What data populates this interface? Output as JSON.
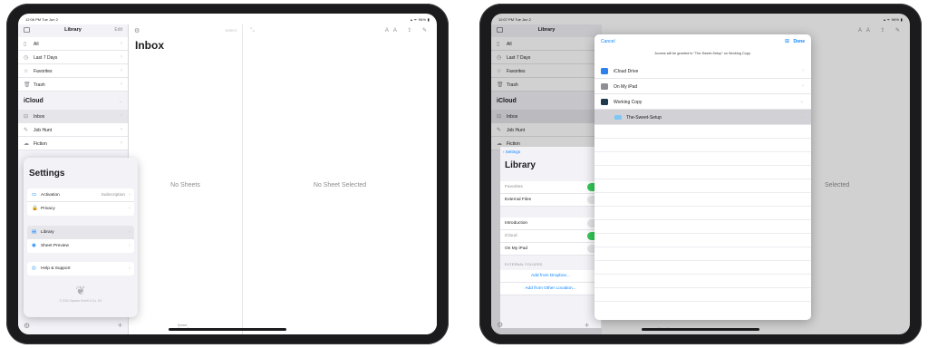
{
  "left": {
    "status": {
      "time": "12:06 PM   Tue Jun 2",
      "right": "▴ ᯤ 96% ▮"
    },
    "sidebar": {
      "title": "Library",
      "edit": "Edit",
      "items": [
        {
          "label": "All",
          "icon": "document-icon"
        },
        {
          "label": "Last 7 Days",
          "icon": "clock-icon"
        },
        {
          "label": "Favorites",
          "icon": "star-icon"
        },
        {
          "label": "Trash",
          "icon": "trash-icon"
        }
      ],
      "section": "iCloud",
      "icloud_items": [
        {
          "label": "Inbox",
          "icon": "inbox-icon"
        },
        {
          "label": "Job Hunt",
          "icon": "pen-icon"
        },
        {
          "label": "Fiction",
          "icon": "cloud-icon"
        }
      ]
    },
    "list": {
      "title": "Inbox",
      "select": "Select",
      "empty": "No Sheets",
      "sorted": "Sorted",
      "sorted2": "Manually"
    },
    "editor": {
      "empty": "No Sheet Selected",
      "aa": "AA"
    },
    "settings": {
      "title": "Settings",
      "group1": [
        {
          "label": "Activation",
          "value": "Subscription"
        },
        {
          "label": "Privacy",
          "value": ""
        }
      ],
      "group2": [
        {
          "label": "Library",
          "value": ""
        },
        {
          "label": "Sheet Preview",
          "value": ""
        }
      ],
      "group3": [
        {
          "label": "Help & Support",
          "value": ""
        }
      ],
      "copyright": "© 2020 Ulysses GmbH & Co. KG"
    }
  },
  "right": {
    "status": {
      "time": "12:07 PM   Tue Jun 2",
      "right": "▴ ᯤ 96% ▮"
    },
    "sidebar": {
      "title": "Library",
      "items": [
        "All",
        "Last 7 Days",
        "Favorites",
        "Trash"
      ],
      "section": "iCloud",
      "icloud_items": [
        "Inbox",
        "Job Hunt",
        "Fiction"
      ]
    },
    "library_panel": {
      "back": "Settings",
      "title": "Library",
      "rows": [
        {
          "label": "Favorites",
          "toggle": true,
          "dim": true
        },
        {
          "label": "External Files",
          "toggle": false,
          "dim": false
        },
        {
          "label": "Introduction",
          "toggle": false,
          "dim": false
        },
        {
          "label": "iCloud",
          "toggle": true,
          "dim": true
        },
        {
          "label": "On My iPad",
          "toggle": false,
          "dim": false
        }
      ],
      "ext_header": "EXTERNAL FOLDERS",
      "links": [
        "Add from Dropbox...",
        "Add from Other Location..."
      ]
    },
    "editor_fragment": "Selected",
    "manually": "Manually",
    "picker": {
      "cancel": "Cancel",
      "done": "Done",
      "notice": "Access will be granted to \"The-Sweet-Setup\" on Working Copy.",
      "rows": [
        {
          "label": "iCloud Drive",
          "icon_color": "#2f80ed",
          "chev": "›"
        },
        {
          "label": "On My iPad",
          "icon_color": "#8e8e93",
          "chev": "›"
        },
        {
          "label": "Working Copy",
          "icon_color": "#1e3a4c",
          "chev": "⌄"
        }
      ],
      "selected_folder": "The-Sweet-Setup"
    }
  }
}
